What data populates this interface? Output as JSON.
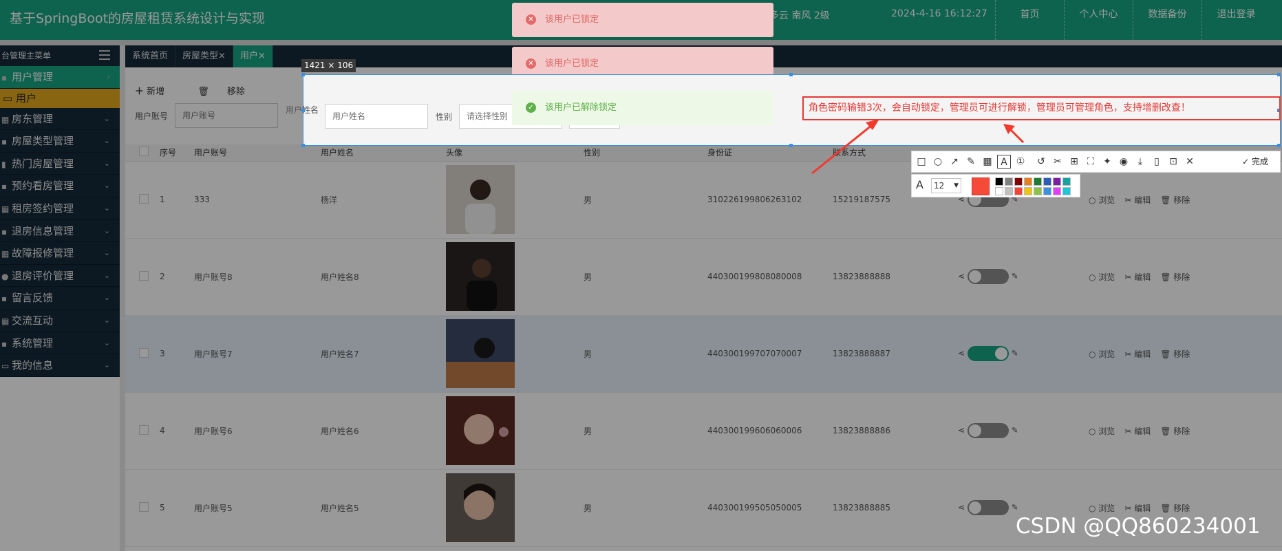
{
  "header": {
    "title": "基于SpringBoot的房屋租赁系统设计与实现",
    "weather": "多云  南风  2级",
    "datetime": "2024-4-16 16:12:27",
    "nav": [
      "首页",
      "个人中心",
      "数据备份",
      "退出登录"
    ]
  },
  "sidebar": {
    "head": "台管理主菜单",
    "items": [
      {
        "label": "用户管理",
        "active": true
      },
      {
        "label": "房东管理"
      },
      {
        "label": "房屋类型管理"
      },
      {
        "label": "热门房屋管理"
      },
      {
        "label": "预约看房管理"
      },
      {
        "label": "租房签约管理"
      },
      {
        "label": "退房信息管理"
      },
      {
        "label": "故障报修管理"
      },
      {
        "label": "退房评价管理"
      },
      {
        "label": "留言反馈"
      },
      {
        "label": "交流互动"
      },
      {
        "label": "系统管理"
      },
      {
        "label": "我的信息"
      }
    ],
    "sub_item": "用户"
  },
  "tabs": [
    {
      "label": "系统首页"
    },
    {
      "label": "房屋类型",
      "close": "×"
    },
    {
      "label": "用户",
      "close": "×",
      "active": true
    }
  ],
  "toolbar": {
    "add": "新增",
    "remove": "移除"
  },
  "filters": {
    "account_label": "用户账号",
    "account_placeholder": "用户账号",
    "name_label": "用户姓名",
    "name_placeholder": "用户姓名",
    "gender_label": "性别",
    "gender_placeholder": "请选择性别"
  },
  "table": {
    "columns": [
      "序号",
      "用户账号",
      "用户姓名",
      "头像",
      "性别",
      "身份证",
      "联系方式"
    ],
    "rows": [
      {
        "no": "1",
        "account": "333",
        "name": "杨洋",
        "gender": "男",
        "id_card": "310226199806263102",
        "phone": "15219187575",
        "locked": false
      },
      {
        "no": "2",
        "account": "用户账号8",
        "name": "用户姓名8",
        "gender": "男",
        "id_card": "440300199808080008",
        "phone": "13823888888",
        "locked": false
      },
      {
        "no": "3",
        "account": "用户账号7",
        "name": "用户姓名7",
        "gender": "男",
        "id_card": "440300199707070007",
        "phone": "13823888887",
        "locked": true
      },
      {
        "no": "4",
        "account": "用户账号6",
        "name": "用户姓名6",
        "gender": "男",
        "id_card": "440300199606060006",
        "phone": "13823888886",
        "locked": false
      },
      {
        "no": "5",
        "account": "用户账号5",
        "name": "用户姓名5",
        "gender": "男",
        "id_card": "440300199505050005",
        "phone": "13823888885",
        "locked": false
      }
    ],
    "actions": {
      "view": "浏览",
      "edit": "编辑",
      "remove": "移除"
    }
  },
  "toasts": {
    "locked": "该用户已锁定",
    "unlocked": "该用户已解除锁定"
  },
  "annotation": {
    "selection_size": "1421 × 106",
    "text": "角色密码输错3次，会自动锁定，管理员可进行解锁，管理员可管理角色，支持增删改查！",
    "done": "完成",
    "font_size": "12",
    "current_color": "#f44a37",
    "swatches": [
      "#000000",
      "#808080",
      "#800000",
      "#e67e22",
      "#1e7b34",
      "#2d5bb8",
      "#7b1fa2",
      "#17a2a2",
      "#ffffff",
      "#c0c0c0",
      "#f44336",
      "#f1c40f",
      "#8bc34a",
      "#3d8fe0",
      "#e040fb",
      "#1ec7d8"
    ]
  },
  "watermark": "CSDN @QQ860234001"
}
